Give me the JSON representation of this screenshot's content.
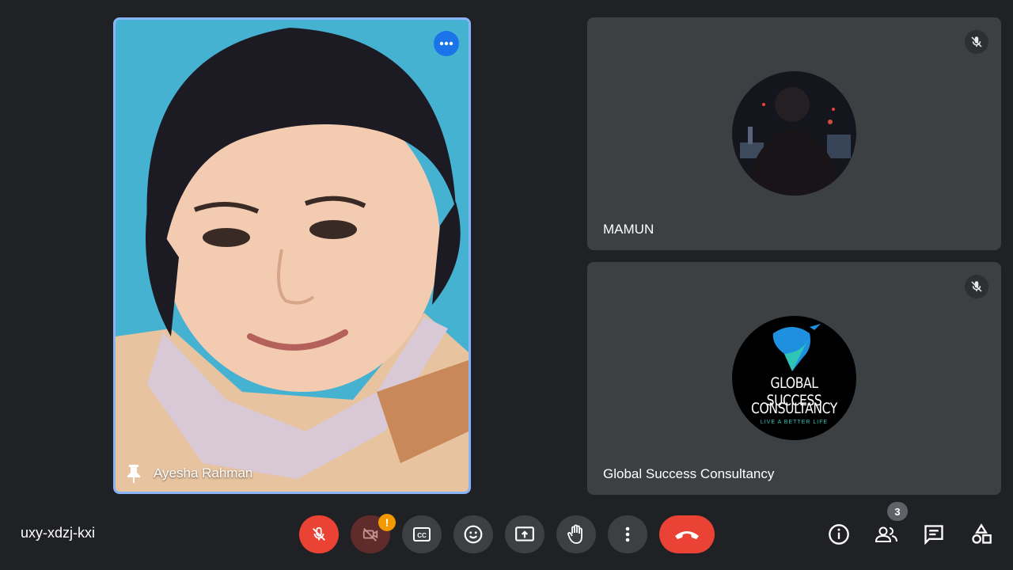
{
  "meeting": {
    "code": "uxy-xdzj-kxi",
    "participant_count": "3"
  },
  "main_tile": {
    "name": "Ayesha Rahman"
  },
  "side_tiles": [
    {
      "name": "MAMUN"
    },
    {
      "name": "Global Success Consultancy",
      "logo": {
        "line1": "GLOBAL SUCCESS",
        "line2": "CONSULTANCY",
        "tagline": "LIVE A BETTER LIFE"
      }
    }
  ],
  "controls": [
    {
      "icon": "mic-off-icon",
      "state": "muted"
    },
    {
      "icon": "camera-off-icon",
      "state": "off-warning"
    },
    {
      "icon": "captions-icon"
    },
    {
      "icon": "emoji-icon"
    },
    {
      "icon": "present-icon"
    },
    {
      "icon": "raise-hand-icon"
    },
    {
      "icon": "more-vert-icon"
    },
    {
      "icon": "hangup-icon"
    }
  ],
  "colors": {
    "accent": "#8ab4f8",
    "danger": "#ea4335",
    "warning": "#f29900",
    "tile_bg": "#3c4043",
    "page_bg": "#202124"
  }
}
